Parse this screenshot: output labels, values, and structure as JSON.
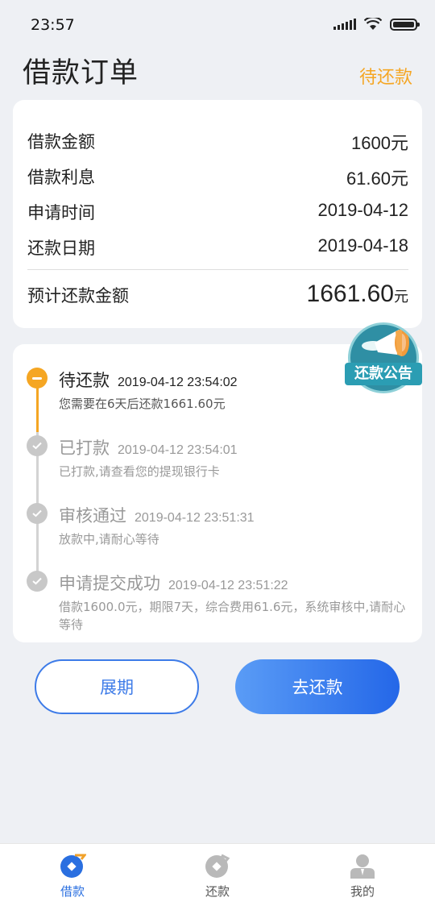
{
  "status_bar": {
    "time": "23:57"
  },
  "header": {
    "title": "借款订单",
    "status": "待还款"
  },
  "summary": {
    "rows": [
      {
        "label": "借款金额",
        "value": "1600元"
      },
      {
        "label": "借款利息",
        "value": "61.60元"
      },
      {
        "label": "申请时间",
        "value": "2019-04-12"
      },
      {
        "label": "还款日期",
        "value": "2019-04-18"
      }
    ],
    "total_label": "预计还款金额",
    "total_value": "1661.60",
    "total_unit": "元"
  },
  "notice_badge": {
    "label": "还款公告",
    "icon": "megaphone-icon"
  },
  "timeline": [
    {
      "title": "待还款",
      "time": "2019-04-12 23:54:02",
      "desc": "您需要在6天后还款1661.60元",
      "state": "active"
    },
    {
      "title": "已打款",
      "time": "2019-04-12 23:54:01",
      "desc": "已打款,请查看您的提现银行卡",
      "state": "done"
    },
    {
      "title": "审核通过",
      "time": "2019-04-12 23:51:31",
      "desc": "放款中,请耐心等待",
      "state": "done"
    },
    {
      "title": "申请提交成功",
      "time": "2019-04-12 23:51:22",
      "desc": "借款1600.0元，期限7天，综合费用61.6元，系统审核中,请耐心等待",
      "state": "done"
    }
  ],
  "actions": {
    "extend_label": "展期",
    "repay_label": "去还款"
  },
  "tabbar": {
    "items": [
      {
        "label": "借款",
        "icon": "loan-icon",
        "active": true
      },
      {
        "label": "还款",
        "icon": "repay-icon",
        "active": false
      },
      {
        "label": "我的",
        "icon": "user-icon",
        "active": false
      }
    ]
  },
  "colors": {
    "accent": "#f5a623",
    "primary": "#2a6fe0",
    "background": "#eef0f4"
  }
}
